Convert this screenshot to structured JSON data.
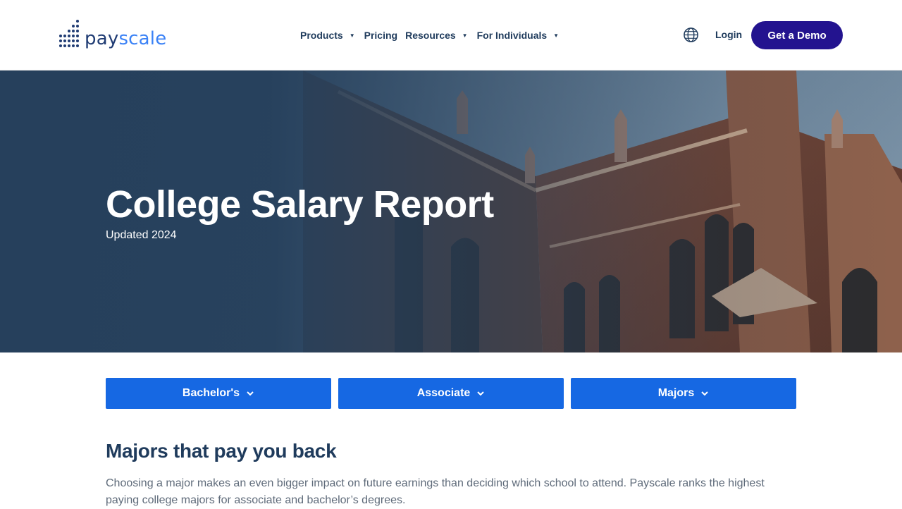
{
  "brand": {
    "logo_part1": "pay",
    "logo_part2": "scale",
    "primary_color": "#23138f",
    "accent_color": "#1668e3"
  },
  "nav": {
    "items": [
      {
        "label": "Products",
        "has_dropdown": true
      },
      {
        "label": "Pricing",
        "has_dropdown": false
      },
      {
        "label": "Resources",
        "has_dropdown": true
      },
      {
        "label": "For Individuals",
        "has_dropdown": true
      }
    ],
    "globe_icon": "globe-icon",
    "login_label": "Login",
    "cta_label": "Get a Demo"
  },
  "hero": {
    "title": "College Salary Report",
    "subtitle": "Updated 2024"
  },
  "filters": [
    {
      "label": "Bachelor's"
    },
    {
      "label": "Associate"
    },
    {
      "label": "Majors"
    }
  ],
  "section": {
    "title": "Majors that pay you back",
    "body": "Choosing a major makes an even bigger impact on future earnings than deciding which school to attend. Payscale ranks the highest paying college majors for associate and bachelor’s degrees."
  }
}
